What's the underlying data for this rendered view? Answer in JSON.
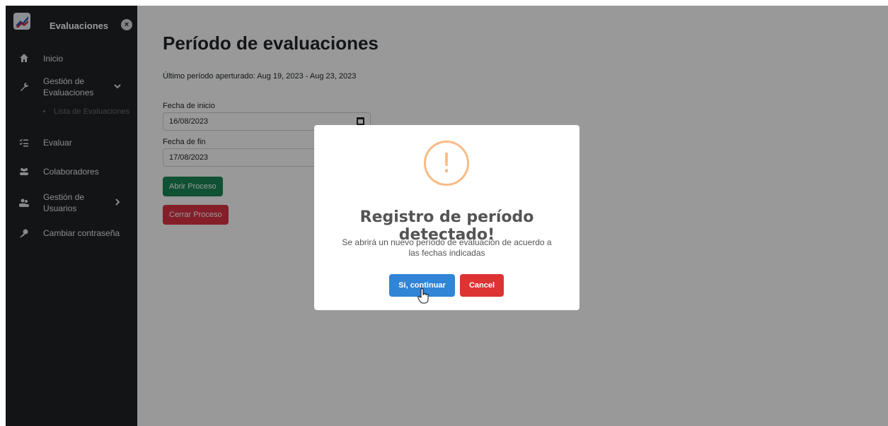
{
  "sidebar": {
    "brand_title": "Evaluaciones",
    "close_glyph": "×",
    "items": [
      {
        "label": "Inicio",
        "icon": "home-icon"
      },
      {
        "label": "Gestión de Evaluaciones",
        "icon": "wrench-icon"
      },
      {
        "label": "Lista de Evaluaciones"
      },
      {
        "label": "Evaluar",
        "icon": "checklist-icon"
      },
      {
        "label": "Colaboradores",
        "icon": "users-icon"
      },
      {
        "label": "Gestión de Usuarios",
        "icon": "user-group-icon"
      },
      {
        "label": "Cambiar contraseña",
        "icon": "key-icon"
      }
    ],
    "gestion_evaluaciones_line1": "Gestión de",
    "gestion_evaluaciones_line2": "Evaluaciones",
    "gestion_usuarios_line1": "Gestión de",
    "gestion_usuarios_line2": "Usuarios"
  },
  "main": {
    "title": "Período de evaluaciones",
    "last_period": "Último período aperturado: Aug 19, 2023 - Aug 23, 2023",
    "start_label": "Fecha de inicio",
    "start_value": "16/08/2023",
    "end_label": "Fecha de fin",
    "end_value": "17/08/2023",
    "open_button": "Abrir Proceso",
    "close_button": "Cerrar Proceso"
  },
  "modal": {
    "icon_glyph": "!",
    "title": "Registro de período detectado!",
    "text_line1": "Se abrirá un nuevo período de evaluación de acuerdo a",
    "text_line2": "las fechas indicadas",
    "confirm_button": "Si, continuar",
    "cancel_button": "Cancel"
  },
  "colors": {
    "sidebar_bg": "#1f2226",
    "green": "#198754",
    "red": "#dc3545",
    "confirm_blue": "#3085d6",
    "cancel_red": "#dd3333",
    "warning_orange": "#f8bb86"
  }
}
